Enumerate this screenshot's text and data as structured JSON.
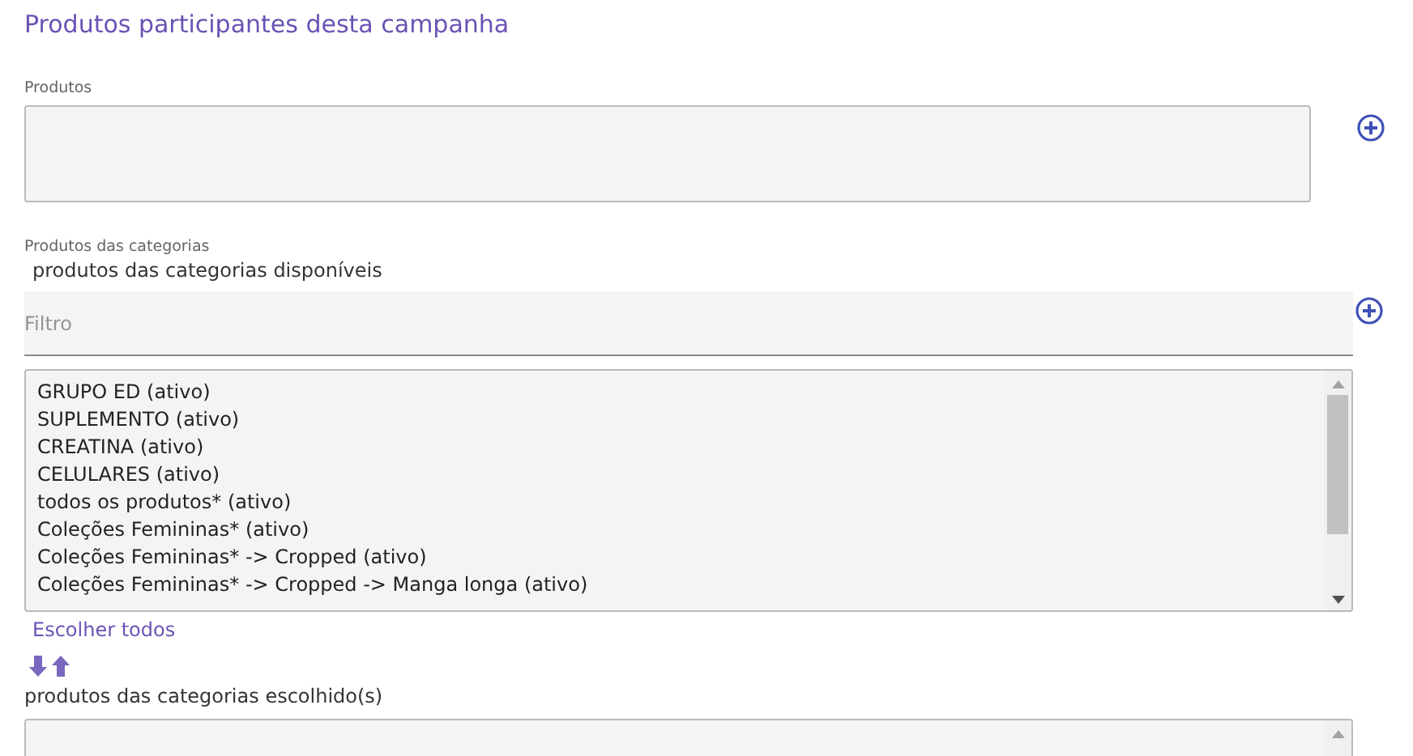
{
  "title": "Produtos participantes desta campanha",
  "produtos": {
    "label": "Produtos"
  },
  "categorias": {
    "label": "Produtos das categorias",
    "available_label": "produtos das categorias disponíveis",
    "filter": {
      "placeholder": "Filtro"
    },
    "available": [
      "GRUPO ED (ativo)",
      "SUPLEMENTO (ativo)",
      "CREATINA (ativo)",
      "CELULARES (ativo)",
      "todos os produtos* (ativo)",
      "Coleções Femininas* (ativo)",
      "Coleções Femininas* -> Cropped (ativo)",
      "Coleções Femininas* -> Cropped -> Manga longa (ativo)"
    ],
    "choose_all": "Escolher todos",
    "chosen_label": "produtos das categorias escolhido(s)"
  }
}
